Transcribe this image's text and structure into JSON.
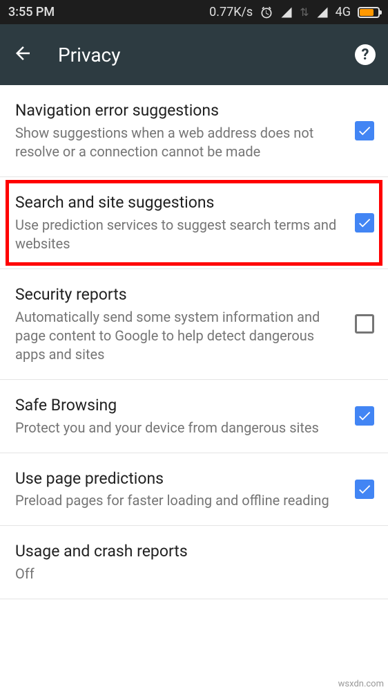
{
  "status_bar": {
    "time": "3:55 PM",
    "speed": "0.77K/s",
    "network_label": "4G"
  },
  "header": {
    "title": "Privacy"
  },
  "settings": [
    {
      "title": "Navigation error suggestions",
      "description": "Show suggestions when a web address does not resolve or a connection cannot be made",
      "checked": true,
      "highlighted": false
    },
    {
      "title": "Search and site suggestions",
      "description": "Use prediction services to suggest search terms and websites",
      "checked": true,
      "highlighted": true
    },
    {
      "title": "Security reports",
      "description": "Automatically send some system information and page content to Google to help detect dangerous apps and sites",
      "checked": false,
      "highlighted": false
    },
    {
      "title": "Safe Browsing",
      "description": "Protect you and your device from dangerous sites",
      "checked": true,
      "highlighted": false
    },
    {
      "title": "Use page predictions",
      "description": "Preload pages for faster loading and offline reading",
      "checked": true,
      "highlighted": false
    },
    {
      "title": "Usage and crash reports",
      "description": "Off",
      "checked": null,
      "highlighted": false
    }
  ],
  "watermark": "wsxdn.com"
}
